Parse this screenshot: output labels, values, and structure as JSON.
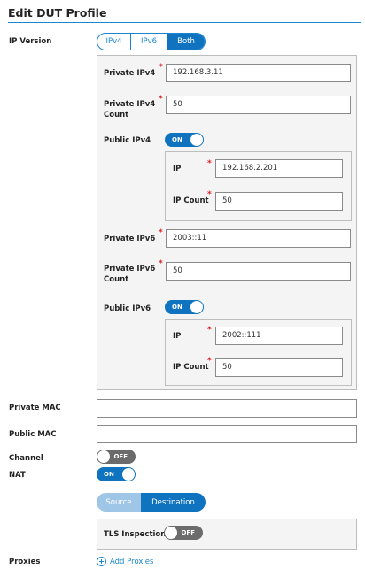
{
  "page": {
    "title": "Edit DUT Profile"
  },
  "ip_version": {
    "label": "IP Version",
    "options": [
      "IPv4",
      "IPv6",
      "Both"
    ],
    "selected": "Both"
  },
  "ipv4": {
    "private_label": "Private IPv4",
    "private_value": "192.168.3.11",
    "private_count_label_1": "Private IPv4",
    "private_count_label_2": "Count",
    "private_count_value": "50",
    "public_label": "Public IPv4",
    "public_toggle": "ON",
    "public_ip_label": "IP",
    "public_ip_value": "192.168.2.201",
    "public_count_label": "IP Count",
    "public_count_value": "50"
  },
  "ipv6": {
    "private_label": "Private IPv6",
    "private_value": "2003::11",
    "private_count_label_1": "Private IPv6",
    "private_count_label_2": "Count",
    "private_count_value": "50",
    "public_label": "Public IPv6",
    "public_toggle": "ON",
    "public_ip_label": "IP",
    "public_ip_value": "2002::111",
    "public_count_label": "IP Count",
    "public_count_value": "50"
  },
  "private_mac": {
    "label": "Private MAC",
    "value": ""
  },
  "public_mac": {
    "label": "Public MAC",
    "value": ""
  },
  "channel": {
    "label": "Channel",
    "toggle": "OFF"
  },
  "nat": {
    "label": "NAT",
    "toggle": "ON",
    "modes": [
      "Source",
      "Destination"
    ],
    "selected_mode": "Destination",
    "tls_label": "TLS Inspection",
    "tls_toggle": "OFF"
  },
  "proxies": {
    "label": "Proxies",
    "add_label": "Add Proxies"
  },
  "colors": {
    "accent": "#0f73c0",
    "required": "#e02020",
    "toggle_off": "#6b6b6b"
  }
}
